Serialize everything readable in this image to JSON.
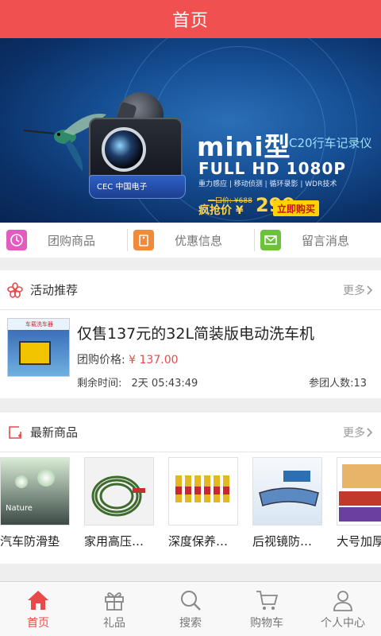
{
  "titlebar": {
    "title": "首页"
  },
  "banner": {
    "headline": "mini型",
    "subhead": "C20行车记录仪",
    "resolution": "FULL HD 1080P",
    "features": "重力感应 | 移动侦测 | 循环录影 | WDR技术",
    "original_price": "一口价: ¥688",
    "price_label": "疯抢价 ¥",
    "price": "299",
    "buy_label": "立即购买",
    "brand": "CEC 中国电子",
    "slide_count": 4,
    "active_slide": 2
  },
  "quicknav": {
    "items": [
      {
        "label": "团购商品",
        "icon": "clock-icon",
        "color": "#e25bbf"
      },
      {
        "label": "优惠信息",
        "icon": "tag-icon",
        "color": "#f08a3c"
      },
      {
        "label": "留言消息",
        "icon": "mail-icon",
        "color": "#6cc23a"
      }
    ]
  },
  "activity": {
    "title": "活动推荐",
    "more": "更多",
    "item": {
      "title": "仅售137元的32L简装版电动洗车机",
      "price_label": "团购价格:",
      "price": "¥ 137.00",
      "time_label": "剩余时间:",
      "time": "2天 05:43:49",
      "participants": "参团人数:13",
      "thumb_caption": "车载洗车器"
    }
  },
  "latest": {
    "title": "最新商品",
    "more": "更多",
    "products": [
      {
        "name": "汽车防滑垫",
        "thumb_text": "Nature"
      },
      {
        "name": "家用高压…"
      },
      {
        "name": "深度保养…"
      },
      {
        "name": "后视镜防…"
      },
      {
        "name": "大号加厚"
      }
    ]
  },
  "tabbar": {
    "tabs": [
      {
        "label": "首页",
        "icon": "home-icon",
        "active": true
      },
      {
        "label": "礼品",
        "icon": "gift-icon"
      },
      {
        "label": "搜索",
        "icon": "search-icon"
      },
      {
        "label": "购物车",
        "icon": "cart-icon"
      },
      {
        "label": "个人中心",
        "icon": "user-icon"
      }
    ]
  },
  "colors": {
    "brand": "#f05050",
    "price": "#e84a4a"
  }
}
